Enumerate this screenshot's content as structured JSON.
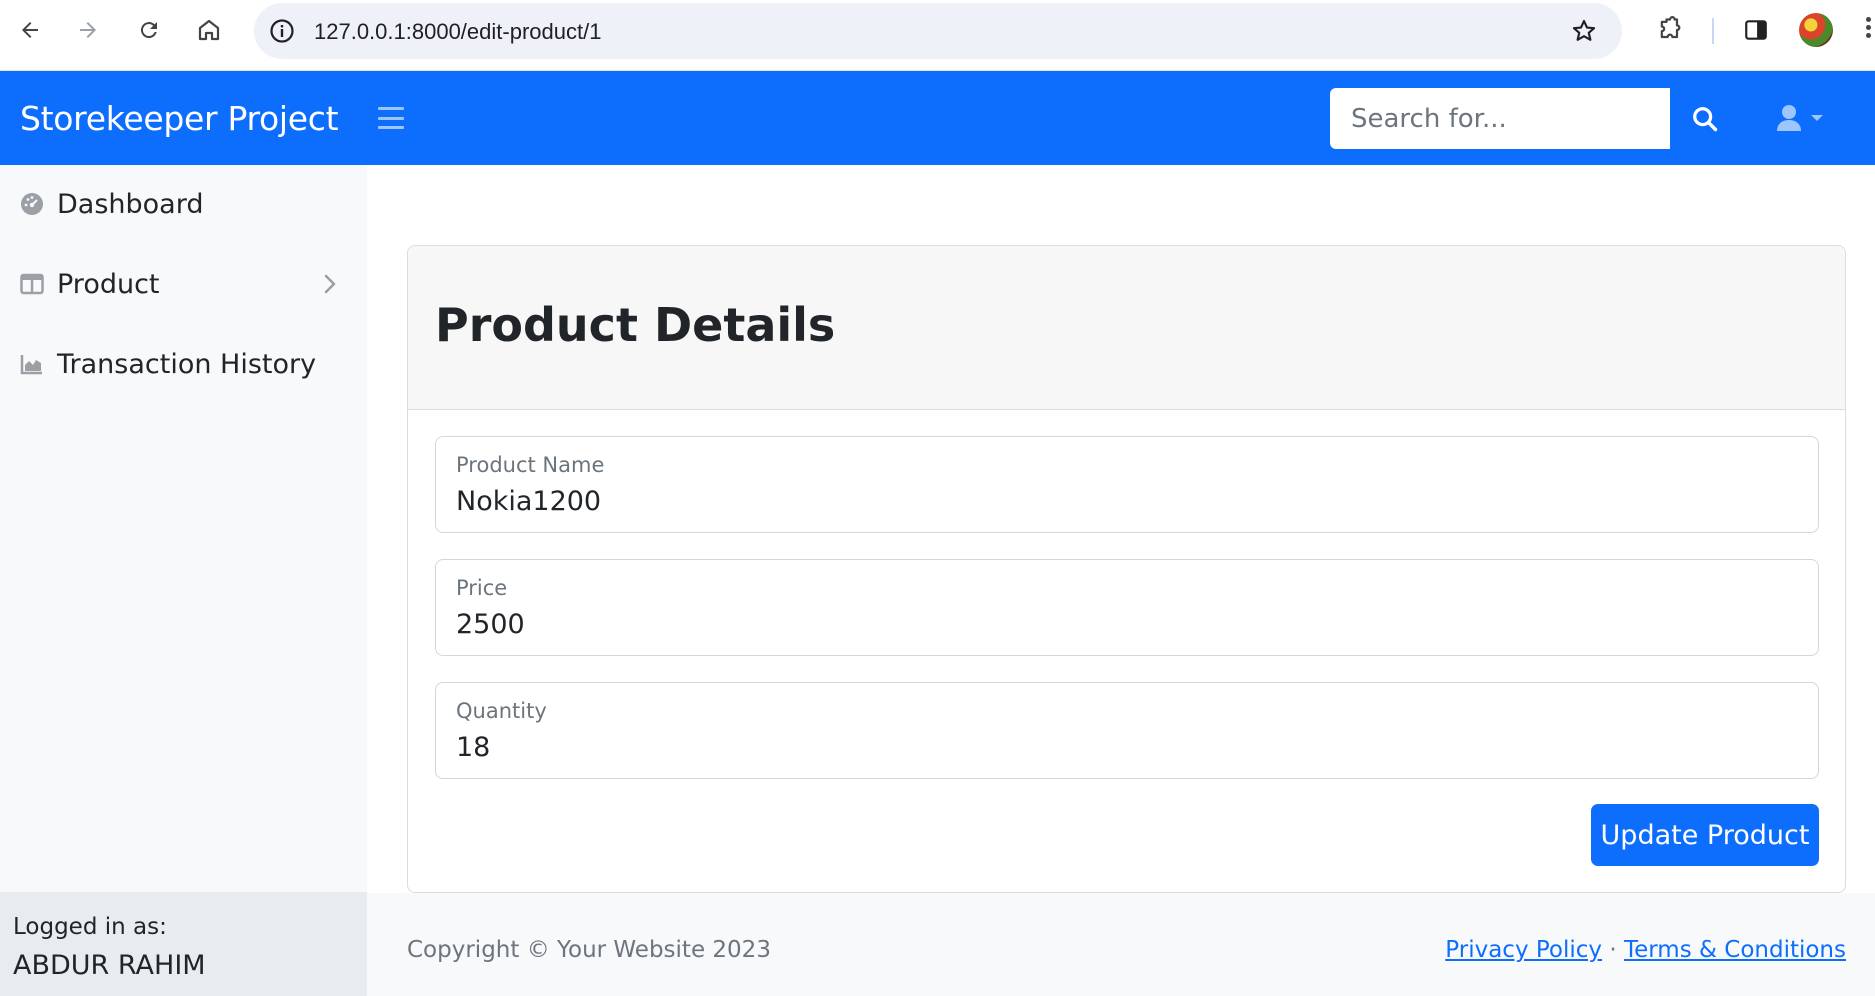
{
  "browser": {
    "url": "127.0.0.1:8000/edit-product/1"
  },
  "navbar": {
    "brand": "Storekeeper Project",
    "search_placeholder": "Search for..."
  },
  "sidebar": {
    "items": [
      {
        "label": "Dashboard",
        "icon": "tachometer-icon"
      },
      {
        "label": "Product",
        "icon": "columns-icon"
      },
      {
        "label": "Transaction History",
        "icon": "chart-area-icon"
      }
    ],
    "footer": {
      "logged_in_label": "Logged in as:",
      "user_name": "ABDUR RAHIM"
    }
  },
  "main": {
    "title": "Product Details",
    "fields": [
      {
        "label": "Product Name",
        "value": "Nokia1200"
      },
      {
        "label": "Price",
        "value": "2500"
      },
      {
        "label": "Quantity",
        "value": "18"
      }
    ],
    "submit_label": "Update Product"
  },
  "footer": {
    "copyright": "Copyright © Your Website 2023",
    "privacy": "Privacy Policy",
    "separator": "·",
    "terms": "Terms & Conditions"
  },
  "colors": {
    "primary": "#0d6efd",
    "sidebar_bg": "#f8f9fa",
    "sidebar_footer_bg": "#e9ecef"
  }
}
